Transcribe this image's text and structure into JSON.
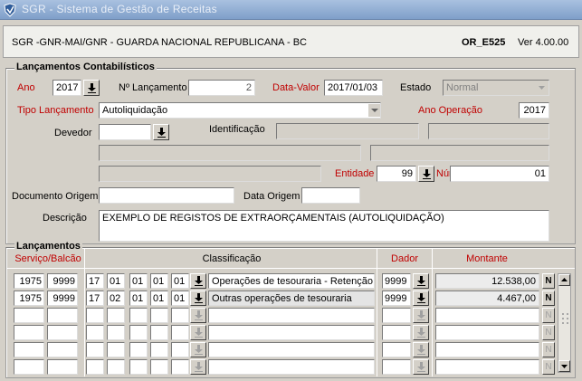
{
  "window": {
    "title": "SGR - Sistema de Gestão de Receitas"
  },
  "header": {
    "org": "SGR -GNR-MAI/GNR - GUARDA NACIONAL REPUBLICANA - BC",
    "form_code": "OR_E525",
    "version": "Ver 4.00.00"
  },
  "lancamentos_contab": {
    "title": "Lançamentos Contabilísticos",
    "ano_label": "Ano",
    "ano_value": "2017",
    "num_label": "Nº Lançamento",
    "num_value": "2",
    "data_valor_label": "Data-Valor",
    "data_valor_value": "2017/01/03",
    "estado_label": "Estado",
    "estado_value": "Normal",
    "tipo_label": "Tipo Lançamento",
    "tipo_value": "Autoliquidação",
    "ano_operacao_label": "Ano Operação",
    "ano_operacao_value": "2017",
    "devedor_label": "Devedor",
    "devedor_value": "",
    "identificacao_label": "Identificação",
    "entidade_label": "Entidade",
    "entidade_value": "99",
    "numero_label": "Número",
    "numero_value": "01",
    "doc_origem_label": "Documento Origem",
    "doc_origem_value": "",
    "data_origem_label": "Data Origem",
    "data_origem_value": "",
    "descricao_label": "Descrição",
    "descricao_value": "EXEMPLO DE REGISTOS DE EXTRAORÇAMENTAIS (AUTOLIQUIDAÇÃO)"
  },
  "lancamentos": {
    "title": "Lançamentos",
    "col_servico": "Serviço/Balcão",
    "col_classificacao": "Classificação",
    "col_dador": "Dador",
    "col_montante": "Montante",
    "n_label": "N",
    "rows": [
      {
        "serv": "1975",
        "balc": "9999",
        "c1": "17",
        "c2": "01",
        "c3": "01",
        "c4": "01",
        "c5": "01",
        "desc": "Operações de tesouraria - Retenção d",
        "dador": "9999",
        "montante": "12.538,00"
      },
      {
        "serv": "1975",
        "balc": "9999",
        "c1": "17",
        "c2": "02",
        "c3": "01",
        "c4": "01",
        "c5": "01",
        "desc": "Outras operações de tesouraria",
        "dador": "9999",
        "montante": "4.467,00"
      },
      {
        "serv": "",
        "balc": "",
        "c1": "",
        "c2": "",
        "c3": "",
        "c4": "",
        "c5": "",
        "desc": "",
        "dador": "",
        "montante": ""
      },
      {
        "serv": "",
        "balc": "",
        "c1": "",
        "c2": "",
        "c3": "",
        "c4": "",
        "c5": "",
        "desc": "",
        "dador": "",
        "montante": ""
      },
      {
        "serv": "",
        "balc": "",
        "c1": "",
        "c2": "",
        "c3": "",
        "c4": "",
        "c5": "",
        "desc": "",
        "dador": "",
        "montante": ""
      },
      {
        "serv": "",
        "balc": "",
        "c1": "",
        "c2": "",
        "c3": "",
        "c4": "",
        "c5": "",
        "desc": "",
        "dador": "",
        "montante": ""
      }
    ]
  },
  "icons": {
    "app": "shield-logo-icon",
    "list": "download-arrow-icon",
    "dropdown": "chevron-down-icon"
  },
  "colors": {
    "title_bar": "#7f9fc9",
    "required_label": "#c00000",
    "panel": "#d4d0c8"
  }
}
